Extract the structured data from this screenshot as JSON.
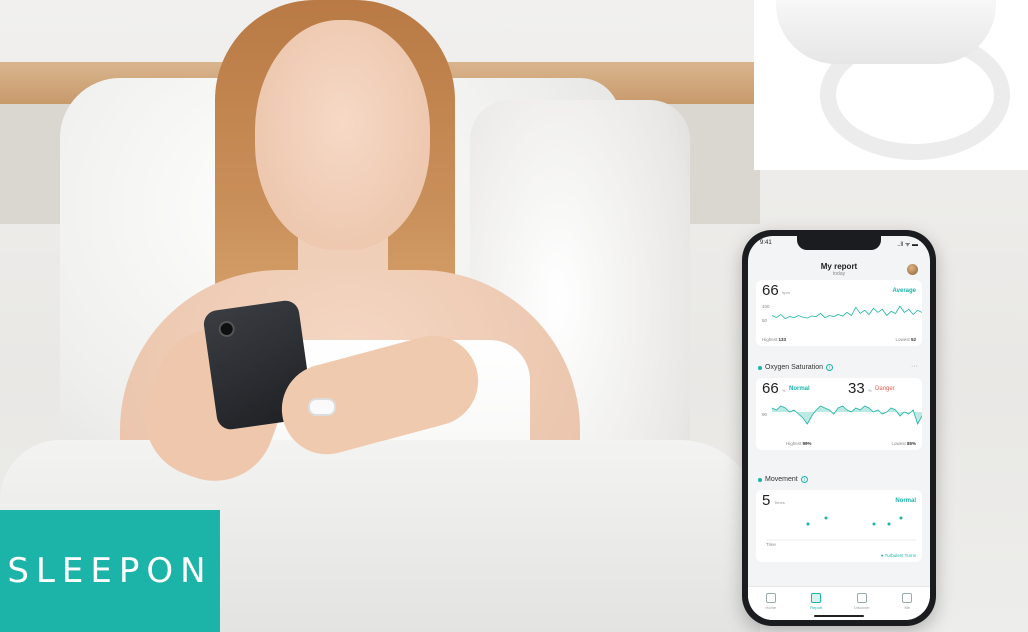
{
  "brand": {
    "name": "SLEEPON",
    "color": "#1cb3a8"
  },
  "app": {
    "status_time": "9:41",
    "status_icons": "..ll ᯤ ▬",
    "title": "My report",
    "subtitle": "today",
    "heart_rate": {
      "value": "66",
      "unit": "bpm",
      "status": "Average",
      "y_tick_high": "100",
      "y_tick_low": "50",
      "highest_label": "Highest",
      "highest_value": "133",
      "lowest_label": "Lowest",
      "lowest_value": "52",
      "series": [
        74,
        70,
        76,
        68,
        72,
        70,
        74,
        71,
        69,
        73,
        72,
        78,
        70,
        74,
        72,
        76,
        73,
        80,
        74,
        90,
        78,
        84,
        76,
        88,
        80,
        86,
        74,
        82,
        78,
        92,
        80,
        86,
        76,
        84,
        80
      ]
    },
    "oxygen": {
      "section_title": "Oxygen Saturation",
      "value_normal": "66",
      "unit_normal": "%",
      "label_normal": "Normal",
      "value_danger": "33",
      "unit_danger": "%",
      "label_danger": "Danger",
      "y_tick": "90",
      "highest_label": "Highest",
      "highest_value": "99%",
      "lowest_label": "Lowest",
      "lowest_value": "85%",
      "series": [
        96,
        95,
        97,
        96,
        94,
        95,
        93,
        91,
        88,
        92,
        95,
        97,
        96,
        95,
        93,
        96,
        97,
        95,
        94,
        96,
        95,
        97,
        96,
        94,
        95,
        93,
        94,
        96,
        95,
        92,
        94,
        93,
        95,
        88,
        92
      ]
    },
    "movement": {
      "section_title": "Movement",
      "value": "5",
      "unit": "Times",
      "status": "Normal",
      "start_label": "Time",
      "legend": "● Turbulent Turns",
      "points": [
        3,
        4,
        3,
        3,
        4
      ]
    },
    "tabs": [
      {
        "label": "Home",
        "active": false
      },
      {
        "label": "Report",
        "active": true
      },
      {
        "label": "Discover",
        "active": false
      },
      {
        "label": "Me",
        "active": false
      }
    ],
    "more_label": "···"
  }
}
